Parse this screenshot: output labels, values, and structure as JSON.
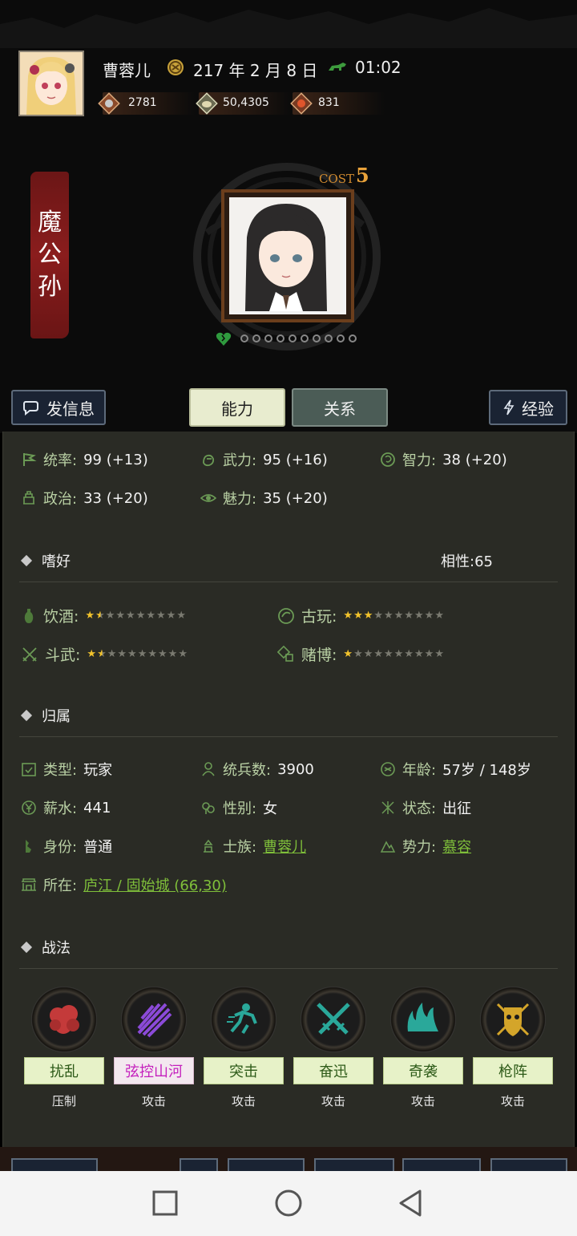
{
  "header": {
    "player_name": "曹蓉儿",
    "date": "217 年 2 月 8 日",
    "time": "01:02",
    "resources": [
      {
        "icon": "coin-icon",
        "value": "2781"
      },
      {
        "icon": "grain-icon",
        "value": "50,4305"
      },
      {
        "icon": "troops-icon",
        "value": "831"
      }
    ]
  },
  "character": {
    "name_chars": [
      "魔",
      "公",
      "孙"
    ],
    "cost_label": "COST",
    "cost_value": "5",
    "level_dots_filled": 0,
    "level_dots_total": 10
  },
  "actions": {
    "message": "发信息",
    "tab_ability": "能力",
    "tab_relation": "关系",
    "experience": "经验"
  },
  "stats": [
    {
      "label": "统率:",
      "value": "99 (+13)",
      "icon": "flag-icon"
    },
    {
      "label": "武力:",
      "value": "95 (+16)",
      "icon": "fist-icon"
    },
    {
      "label": "智力:",
      "value": "38 (+20)",
      "icon": "brain-icon"
    },
    {
      "label": "政治:",
      "value": "33 (+20)",
      "icon": "building-icon"
    },
    {
      "label": "魅力:",
      "value": "35 (+20)",
      "icon": "eye-icon"
    }
  ],
  "hobbies": {
    "title": "嗜好",
    "affinity": "相性:65",
    "items": [
      {
        "label": "饮酒:",
        "icon": "wine-icon",
        "stars": 1.5,
        "max": 10
      },
      {
        "label": "古玩:",
        "icon": "antique-icon",
        "stars": 3,
        "max": 10
      },
      {
        "label": "斗武:",
        "icon": "swords-icon",
        "stars": 1.5,
        "max": 10
      },
      {
        "label": "赌博:",
        "icon": "dice-icon",
        "stars": 1,
        "max": 10
      }
    ]
  },
  "belong": {
    "title": "归属",
    "rows": [
      {
        "label": "类型:",
        "value": "玩家",
        "icon": "calendar-check-icon"
      },
      {
        "label": "统兵数:",
        "value": "3900",
        "icon": "soldier-icon"
      },
      {
        "label": "年龄:",
        "value": "57岁 / 148岁",
        "icon": "age-icon"
      },
      {
        "label": "薪水:",
        "value": "441",
        "icon": "yen-icon"
      },
      {
        "label": "性别:",
        "value": "女",
        "icon": "gender-icon"
      },
      {
        "label": "状态:",
        "value": "出征",
        "icon": "status-icon"
      },
      {
        "label": "身份:",
        "value": "普通",
        "icon": "identity-icon"
      },
      {
        "label": "士族:",
        "value": "曹蓉儿",
        "icon": "clan-icon",
        "link": true
      },
      {
        "label": "势力:",
        "value": "慕容",
        "icon": "mountain-icon",
        "link": true
      }
    ],
    "location_label": "所在:",
    "location_value": "庐江 / 固始城 (66,30)"
  },
  "tactics": {
    "title": "战法",
    "items": [
      {
        "name": "扰乱",
        "type": "压制",
        "icon": "chaos-cloud-icon",
        "color": "#c43a3a",
        "name_color": "#2d5a18",
        "name_bg": "#e7f2c8"
      },
      {
        "name": "弦控山河",
        "type": "攻击",
        "icon": "arrow-volley-icon",
        "color": "#7a3ac8",
        "name_color": "#c41fbd",
        "name_bg": "#f3e8ef"
      },
      {
        "name": "突击",
        "type": "攻击",
        "icon": "charge-icon",
        "color": "#2aa89a",
        "name_color": "#2d5a18",
        "name_bg": "#e7f2c8"
      },
      {
        "name": "奋迅",
        "type": "攻击",
        "icon": "crossed-swords-icon",
        "color": "#2aa89a",
        "name_color": "#2d5a18",
        "name_bg": "#e7f2c8"
      },
      {
        "name": "奇袭",
        "type": "攻击",
        "icon": "flame-icon",
        "color": "#2aa89a",
        "name_color": "#2d5a18",
        "name_bg": "#e7f2c8"
      },
      {
        "name": "枪阵",
        "type": "攻击",
        "icon": "shield-spear-icon",
        "color": "#d4a52a",
        "name_color": "#2d5a18",
        "name_bg": "#e7f2c8"
      }
    ]
  },
  "colors": {
    "accent_green": "#b9d0a4",
    "link_green": "#7fbf3a",
    "banner_red": "#8a1d1d",
    "panel_bg": "#2a2b25"
  }
}
